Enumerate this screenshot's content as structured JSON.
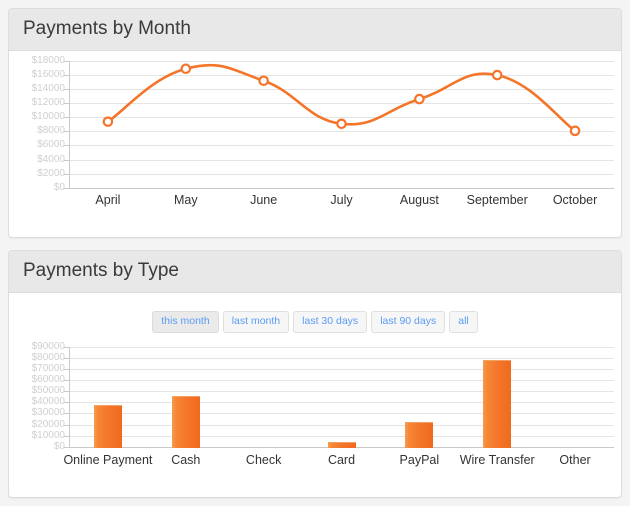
{
  "theme": {
    "accent": "#f4752a",
    "page_bg": "#f4f4f4",
    "panel_bg": "#ffffff",
    "panel_heading_bg": "#e8e8e8",
    "panel_border": "#dddddd",
    "gridline": "#e4e4e4",
    "axis_label": "#333333",
    "ylabel": "#cfcfcf",
    "filter_link": "#5a9bf6"
  },
  "panels": {
    "payments_by_month": {
      "title": "Payments by Month"
    },
    "payments_by_type": {
      "title": "Payments by Type",
      "filters": [
        {
          "label": "this month",
          "active": true
        },
        {
          "label": "last month",
          "active": false
        },
        {
          "label": "last 30 days",
          "active": false
        },
        {
          "label": "last 90 days",
          "active": false
        },
        {
          "label": "all",
          "active": false
        }
      ]
    }
  },
  "chart_data": [
    {
      "type": "line",
      "title": "Payments by Month",
      "xlabel": "",
      "ylabel": "",
      "categories": [
        "April",
        "May",
        "June",
        "July",
        "August",
        "September",
        "October"
      ],
      "values": [
        9400,
        16900,
        15200,
        9100,
        12600,
        16000,
        8100
      ],
      "ylim": [
        0,
        18000
      ],
      "ytick_step": 2000,
      "ytick_labels": [
        "$0",
        "$2000",
        "$4000",
        "$6000",
        "$8000",
        "$10000",
        "$12000",
        "$14000",
        "$16000",
        "$18000"
      ],
      "grid": true,
      "legend": "none",
      "line_color": "#f4752a",
      "marker": "circle-open",
      "curve": "smooth"
    },
    {
      "type": "bar",
      "title": "Payments by Type",
      "xlabel": "",
      "ylabel": "",
      "categories": [
        "Online Payment",
        "Cash",
        "Check",
        "Card",
        "PayPal",
        "Wire Transfer",
        "Other"
      ],
      "values": [
        38000,
        45500,
        0,
        4200,
        22500,
        78500,
        0
      ],
      "ylim": [
        0,
        90000
      ],
      "ytick_step": 10000,
      "ytick_labels": [
        "$0",
        "$10000",
        "$20000",
        "$30000",
        "$40000",
        "$50000",
        "$60000",
        "$70000",
        "$80000",
        "$90000"
      ],
      "grid": true,
      "legend": "none",
      "bar_color": "#f4752a"
    }
  ]
}
